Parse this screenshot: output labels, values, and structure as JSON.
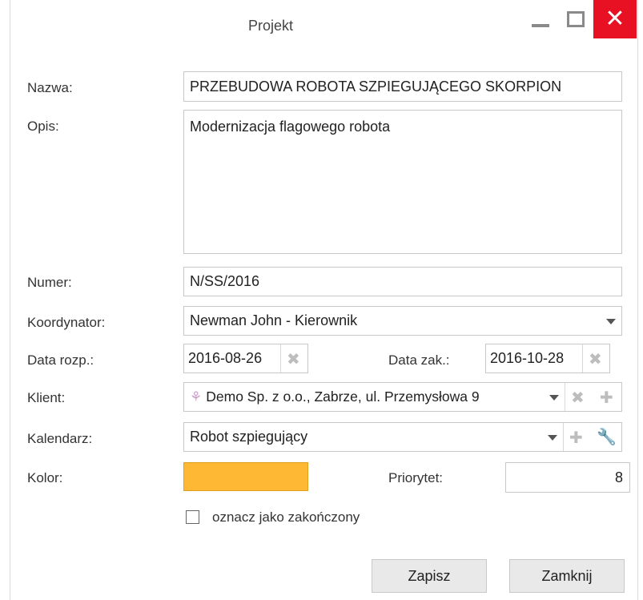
{
  "window": {
    "title": "Projekt",
    "minimize_glyph": "▁",
    "close_glyph": "✕"
  },
  "form": {
    "name": {
      "label": "Nazwa:",
      "value": "PRZEBUDOWA ROBOTA SZPIEGUJĄCEGO SKORPION"
    },
    "description": {
      "label": "Opis:",
      "value": "Modernizacja flagowego robota"
    },
    "number": {
      "label": "Numer:",
      "value": "N/SS/2016"
    },
    "coordinator": {
      "label": "Koordynator:",
      "value": "Newman John - Kierownik"
    },
    "start_date": {
      "label": "Data rozp.:",
      "value": "2016-08-26"
    },
    "end_date": {
      "label": "Data zak.:",
      "value": "2016-10-28"
    },
    "client": {
      "label": "Klient:",
      "value": "Demo Sp. z o.o., Zabrze, ul. Przemysłowa 9",
      "icon": "client-icon"
    },
    "calendar": {
      "label": "Kalendarz:",
      "value": "Robot szpiegujący"
    },
    "color": {
      "label": "Kolor:",
      "value": "#ffb833"
    },
    "priority": {
      "label": "Priorytet:",
      "value": "8"
    },
    "completed": {
      "label": "oznacz jako zakończony",
      "checked": false
    }
  },
  "icons": {
    "clear": "✖",
    "add": "✚",
    "settings": "🔧"
  },
  "buttons": {
    "save": "Zapisz",
    "close": "Zamknij"
  }
}
